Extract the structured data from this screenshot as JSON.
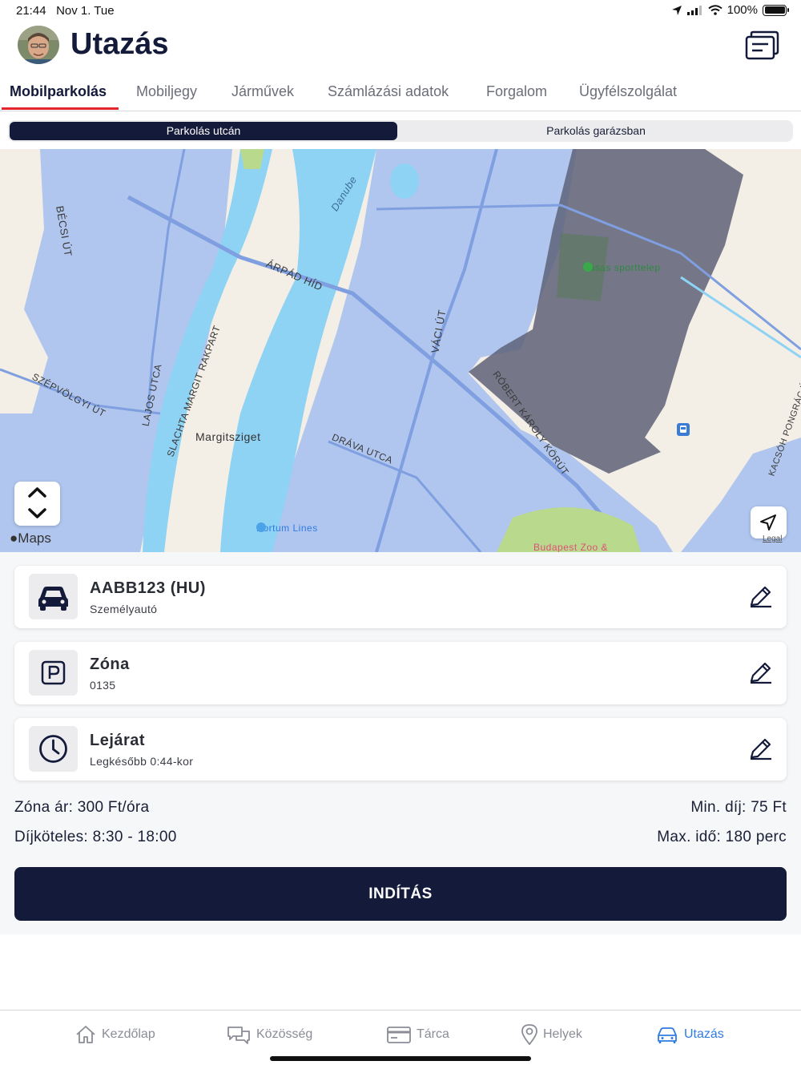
{
  "status_bar": {
    "time": "21:44",
    "date": "Nov 1. Tue",
    "battery": "100%"
  },
  "header": {
    "title": "Utazás"
  },
  "tabs": [
    {
      "label": "Mobilparkolás",
      "active": true
    },
    {
      "label": "Mobiljegy"
    },
    {
      "label": "Járművek"
    },
    {
      "label": "Számlázási adatok"
    },
    {
      "label": "Forgalom"
    },
    {
      "label": "Ügyfélszolgálat"
    }
  ],
  "segment": {
    "street": "Parkolás utcán",
    "garage": "Parkolás garázsban",
    "selected": "street"
  },
  "map": {
    "labels": {
      "danube": "Danube",
      "arpad": "ÁRPÁD HÍD",
      "becsi": "BÉCSI ÚT",
      "vasas": "Vasas sporttelep",
      "vaci": "VÁCI ÚT",
      "robert": "RÓBERT KÁROLY KÖRÚT",
      "szepvolgyi": "SZÉPVÖLGYI ÚT",
      "lajos": "LAJOS UTCA",
      "slachta": "SLACHTA MARGIT RAKPART",
      "margitsziget": "Margitsziget",
      "drava": "DRÁVA UTCA",
      "kacsoh": "KACSÓH PONGRÁC ÚT",
      "portum": "Portum Lines",
      "zoo": "Budapest Zoo &",
      "maps": "Maps",
      "legal": "Legal"
    },
    "icons": [
      "chevron-up-down-icon",
      "location-arrow-icon",
      "bus-stop-icon"
    ],
    "colors": {
      "zone_fill": "#a9c1ee",
      "active_zone": "#5e6278",
      "water": "#8ed2f4",
      "land": "#f3efe6"
    }
  },
  "cards": [
    {
      "title": "AABB123 (HU)",
      "subtitle": "Személyautó",
      "icon": "car-icon"
    },
    {
      "title": "Zóna",
      "subtitle": "0135",
      "icon": "parking-icon"
    },
    {
      "title": "Lejárat",
      "subtitle": "Legkésőbb 0:44-kor",
      "icon": "clock-icon"
    }
  ],
  "info": {
    "zone_price": "Zóna ár: 300 Ft/óra",
    "min_fee": "Min. díj: 75 Ft",
    "paid_hours": "Díjköteles: 8:30 - 18:00",
    "max_time": "Max. idő: 180 perc"
  },
  "start_button": "INDÍTÁS",
  "tabbar": [
    {
      "label": "Kezdőlap",
      "icon": "home-icon"
    },
    {
      "label": "Közösség",
      "icon": "chat-bubbles-icon"
    },
    {
      "label": "Tárca",
      "icon": "wallet-card-icon"
    },
    {
      "label": "Helyek",
      "icon": "map-pin-icon"
    },
    {
      "label": "Utazás",
      "icon": "car-travel-icon",
      "active": true
    }
  ],
  "accent_colors": {
    "navy": "#131a3a",
    "red": "#e4252b",
    "blue": "#2f7be0"
  }
}
